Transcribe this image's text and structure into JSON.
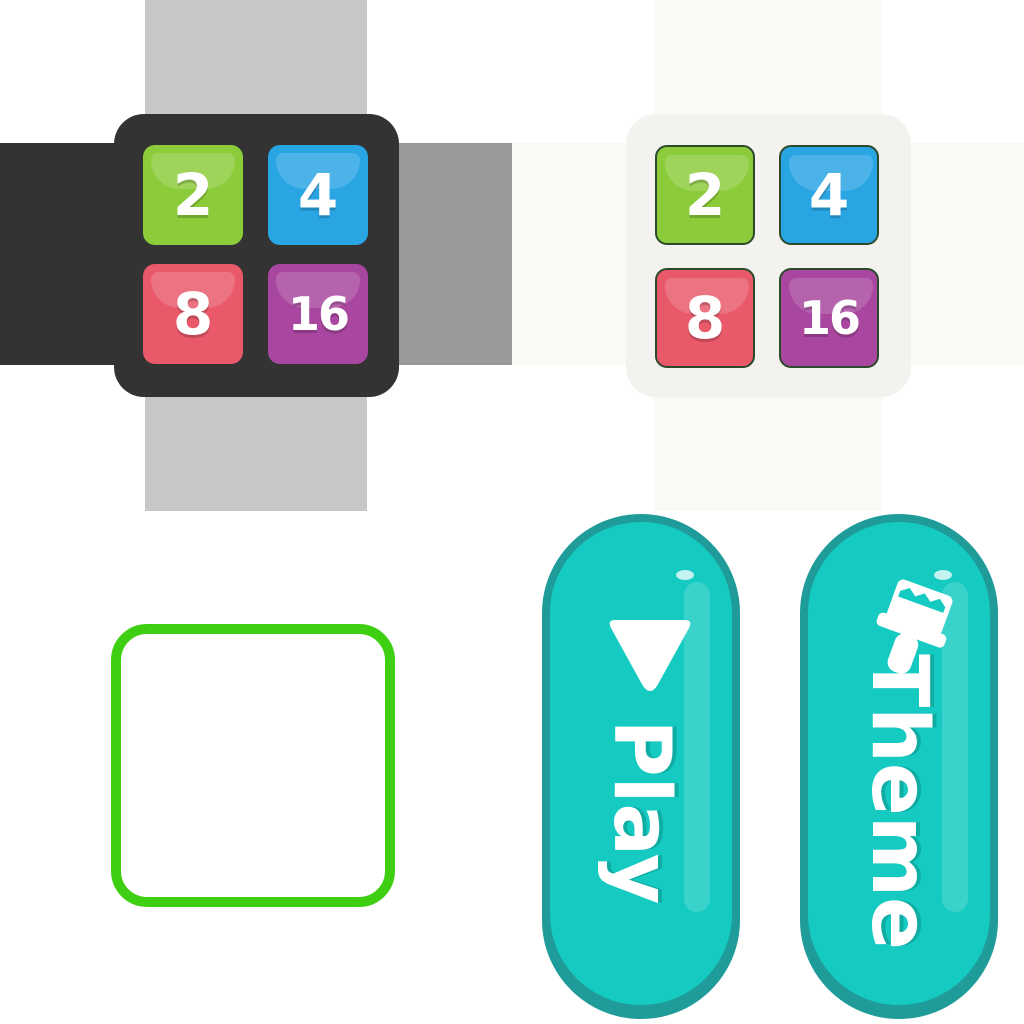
{
  "watch_dark": {
    "tiles": [
      {
        "label": "2",
        "color": "#8ccc3a"
      },
      {
        "label": "4",
        "color": "#2aa5e4"
      },
      {
        "label": "8",
        "color": "#e9596a"
      },
      {
        "label": "16",
        "color": "#a9469f"
      }
    ],
    "case_color": "#333333"
  },
  "watch_light": {
    "tiles": [
      {
        "label": "2",
        "color": "#8ccc3a"
      },
      {
        "label": "4",
        "color": "#2aa5e4"
      },
      {
        "label": "8",
        "color": "#e9596a"
      },
      {
        "label": "16",
        "color": "#a9469f"
      }
    ],
    "case_color": "#f4f2ee"
  },
  "frame": {
    "color": "#3fcf12"
  },
  "buttons": {
    "play": {
      "label": "Play",
      "icon": "play-icon"
    },
    "theme": {
      "label": "Theme",
      "icon": "paint-brush-icon"
    }
  },
  "accent": "#15cbc1"
}
